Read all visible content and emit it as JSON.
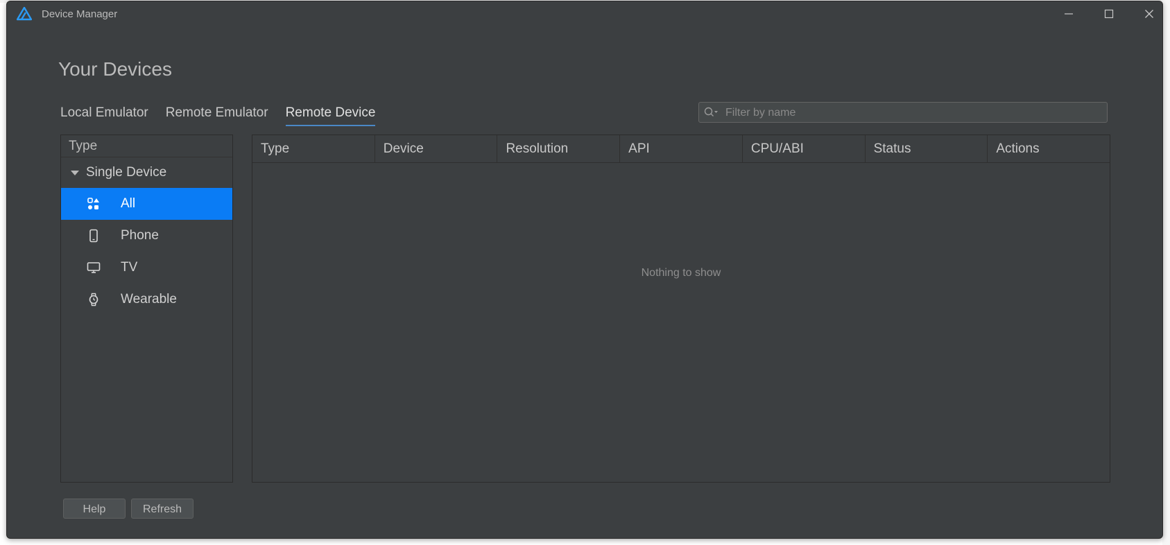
{
  "window": {
    "title": "Device Manager",
    "controls": [
      "minimize-icon",
      "maximize-icon",
      "close-icon"
    ]
  },
  "page": {
    "heading": "Your Devices"
  },
  "tabs": [
    {
      "label": "Local Emulator",
      "active": false
    },
    {
      "label": "Remote Emulator",
      "active": false
    },
    {
      "label": "Remote Device",
      "active": true
    }
  ],
  "filter": {
    "placeholder": "Filter by name",
    "value": "",
    "icon": "search-icon"
  },
  "tree": {
    "header": "Type",
    "group": "Single Device",
    "items": [
      {
        "label": "All",
        "icon": "grid-shapes-icon",
        "selected": true
      },
      {
        "label": "Phone",
        "icon": "phone-icon",
        "selected": false
      },
      {
        "label": "TV",
        "icon": "tv-icon",
        "selected": false
      },
      {
        "label": "Wearable",
        "icon": "watch-icon",
        "selected": false
      }
    ]
  },
  "table": {
    "columns": [
      "Type",
      "Device",
      "Resolution",
      "API",
      "CPU/ABI",
      "Status",
      "Actions"
    ],
    "rows": [],
    "empty_text": "Nothing to show"
  },
  "buttons": {
    "help": "Help",
    "refresh": "Refresh"
  },
  "colors": {
    "background": "#3c3f41",
    "selection": "#0a7cf5",
    "tab_underline": "#4a88c7",
    "logo_blue": "#2b9bf4"
  }
}
